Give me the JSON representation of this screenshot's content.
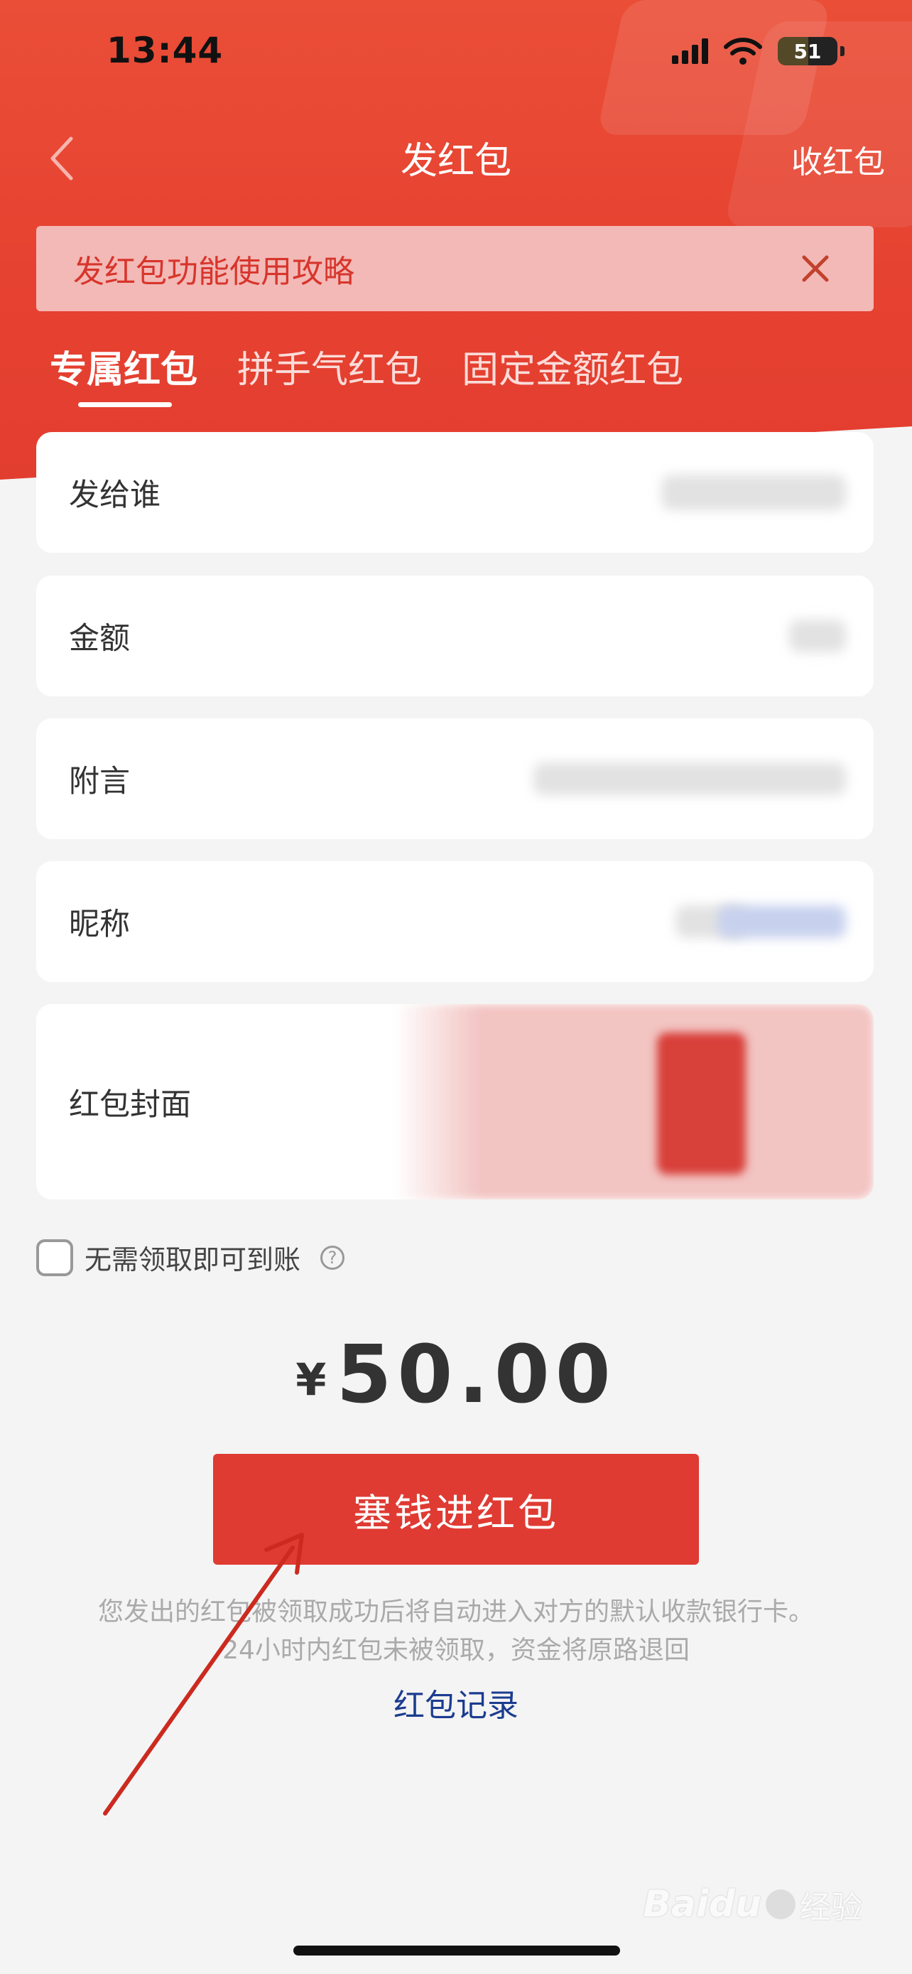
{
  "status_bar": {
    "time": "13:44",
    "battery": "51",
    "battery_level": 0.51
  },
  "nav": {
    "title": "发红包",
    "right_action": "收红包"
  },
  "banner": {
    "text": "发红包功能使用攻略"
  },
  "tabs": [
    {
      "label": "专属红包",
      "active": true
    },
    {
      "label": "拼手气红包",
      "active": false
    },
    {
      "label": "固定金额红包",
      "active": false
    }
  ],
  "form": {
    "recipient_label": "发给谁",
    "amount_label": "金额",
    "message_label": "附言",
    "nickname_label": "昵称",
    "cover_label": "红包封面"
  },
  "agreement": {
    "text": "无需领取即可到账",
    "checked": false
  },
  "total": {
    "currency": "¥",
    "value": "50.00"
  },
  "cta": {
    "label": "塞钱进红包"
  },
  "note": {
    "line1": "您发出的红包被领取成功后将自动进入对方的默认收款银行卡。",
    "line2": "24小时内红包未被领取，资金将原路退回"
  },
  "records_link": "红包记录",
  "watermark": {
    "logo": "Baidu",
    "text": "经验"
  },
  "colors": {
    "brand_red": "#e23d2f",
    "button_red": "#df3b33",
    "link_blue": "#1b3c8f"
  }
}
